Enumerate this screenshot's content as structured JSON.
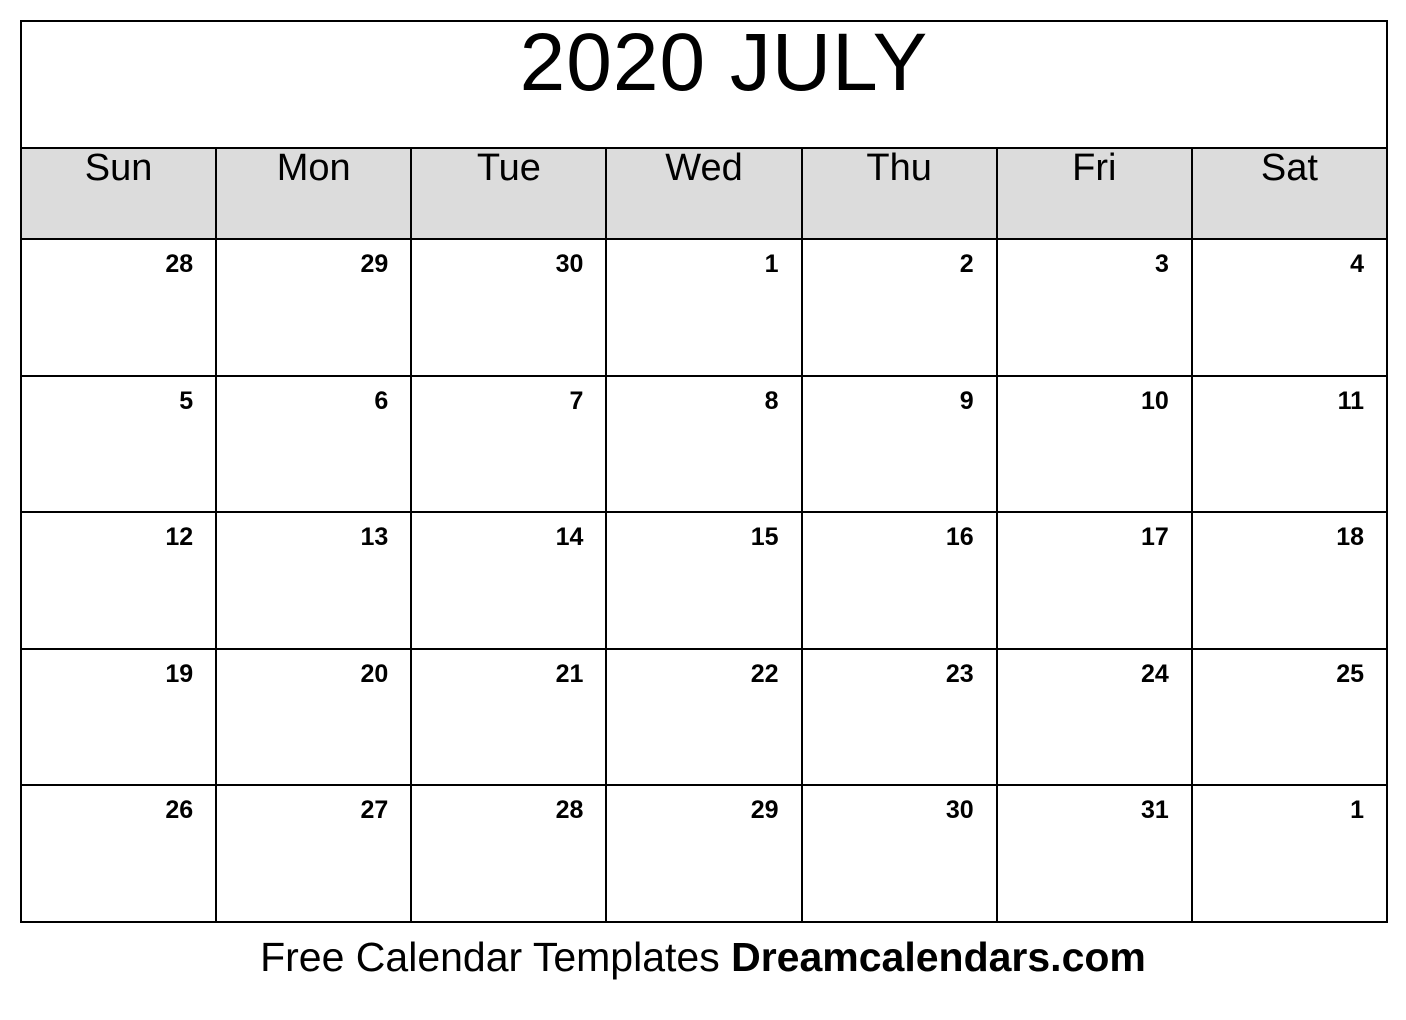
{
  "calendar": {
    "title": "2020 JULY",
    "year": "2020",
    "month": "JULY",
    "header_background": "#dcdcdc",
    "page_background": "#ffffff",
    "border_color": "#000000",
    "weekdays": [
      {
        "label": "Sun"
      },
      {
        "label": "Mon"
      },
      {
        "label": "Tue"
      },
      {
        "label": "Wed"
      },
      {
        "label": "Thu"
      },
      {
        "label": "Fri"
      },
      {
        "label": "Sat"
      }
    ],
    "weeks": [
      [
        {
          "num": "28",
          "in_month": false
        },
        {
          "num": "29",
          "in_month": false
        },
        {
          "num": "30",
          "in_month": false
        },
        {
          "num": "1",
          "in_month": true
        },
        {
          "num": "2",
          "in_month": true
        },
        {
          "num": "3",
          "in_month": true
        },
        {
          "num": "4",
          "in_month": true
        }
      ],
      [
        {
          "num": "5",
          "in_month": true
        },
        {
          "num": "6",
          "in_month": true
        },
        {
          "num": "7",
          "in_month": true
        },
        {
          "num": "8",
          "in_month": true
        },
        {
          "num": "9",
          "in_month": true
        },
        {
          "num": "10",
          "in_month": true
        },
        {
          "num": "11",
          "in_month": true
        }
      ],
      [
        {
          "num": "12",
          "in_month": true
        },
        {
          "num": "13",
          "in_month": true
        },
        {
          "num": "14",
          "in_month": true
        },
        {
          "num": "15",
          "in_month": true
        },
        {
          "num": "16",
          "in_month": true
        },
        {
          "num": "17",
          "in_month": true
        },
        {
          "num": "18",
          "in_month": true
        }
      ],
      [
        {
          "num": "19",
          "in_month": true
        },
        {
          "num": "20",
          "in_month": true
        },
        {
          "num": "21",
          "in_month": true
        },
        {
          "num": "22",
          "in_month": true
        },
        {
          "num": "23",
          "in_month": true
        },
        {
          "num": "24",
          "in_month": true
        },
        {
          "num": "25",
          "in_month": true
        }
      ],
      [
        {
          "num": "26",
          "in_month": true
        },
        {
          "num": "27",
          "in_month": true
        },
        {
          "num": "28",
          "in_month": true
        },
        {
          "num": "29",
          "in_month": true
        },
        {
          "num": "30",
          "in_month": true
        },
        {
          "num": "31",
          "in_month": true
        },
        {
          "num": "1",
          "in_month": false
        }
      ]
    ]
  },
  "footer": {
    "tagline": "Free Calendar Templates",
    "brand": "Dreamcalendars.com"
  }
}
